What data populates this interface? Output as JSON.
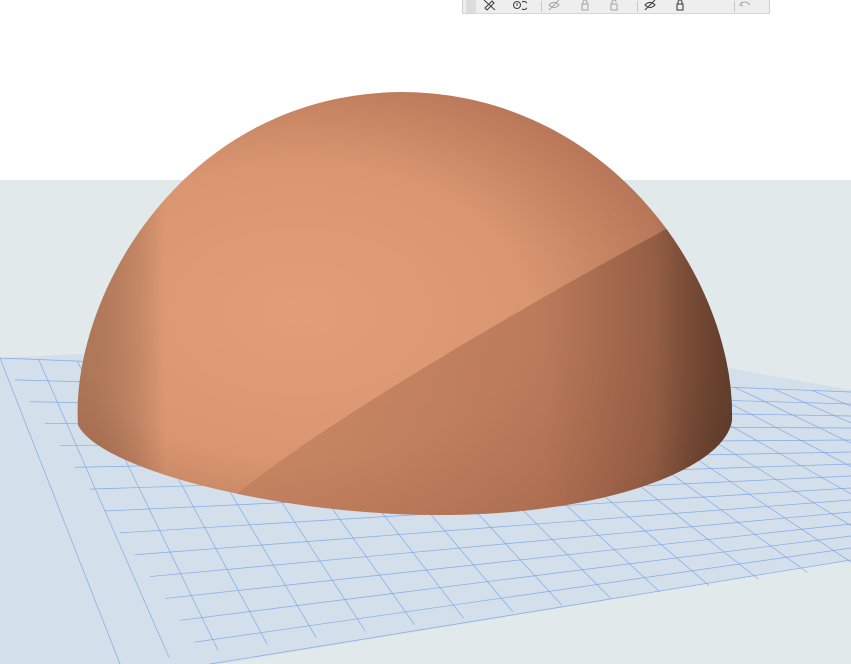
{
  "app": {
    "view_mode": "3D"
  },
  "colors": {
    "sky": "#ffffff",
    "backdrop": "#e2e9ea",
    "ground": "#d3dfeb",
    "grid_line": "#6f9ee6",
    "dome_light": "#e09c78",
    "dome_mid": "#c78460",
    "dome_dark": "#7f523a",
    "toolbar_bg": "#eeeeee",
    "icon": "#555555"
  },
  "toolbar": {
    "buttons": [
      {
        "name": "edit-visibility-button",
        "icon": "pencil-slash-icon",
        "enabled": true
      },
      {
        "name": "rotate-button",
        "icon": "rotate-icon",
        "enabled": true
      },
      {
        "name": "hide-button",
        "icon": "eye-slash-icon",
        "enabled": false
      },
      {
        "name": "lock-button",
        "icon": "lock-icon",
        "enabled": false
      },
      {
        "name": "unlock-button",
        "icon": "unlock-icon",
        "enabled": false
      },
      {
        "name": "hide-all-button",
        "icon": "eye-slash-icon",
        "enabled": true
      },
      {
        "name": "lock-all-button",
        "icon": "lock-icon",
        "enabled": true
      },
      {
        "name": "undo-button",
        "icon": "undo-icon",
        "enabled": false
      }
    ]
  },
  "scene": {
    "object": "hemisphere",
    "ground_grid": true
  }
}
